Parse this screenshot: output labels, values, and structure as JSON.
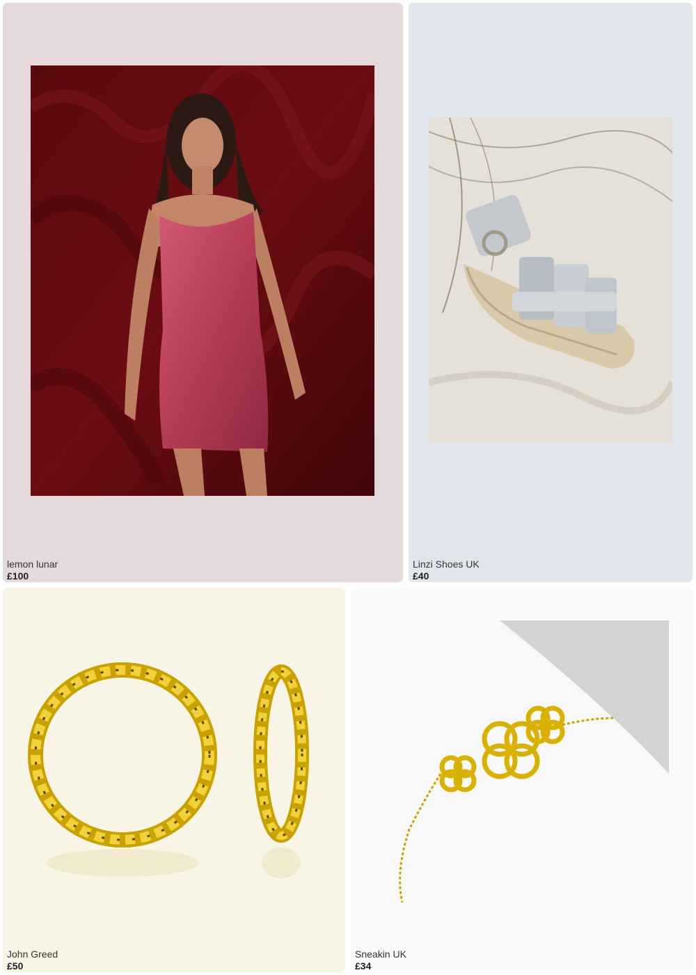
{
  "products": [
    {
      "brand": "lemon lunar",
      "price": "£100",
      "image_icon": "pink-sequin-dress-photo",
      "background": "#e5d9dc"
    },
    {
      "brand": "Linzi Shoes UK",
      "price": "£40",
      "image_icon": "silver-sandal-photo",
      "background": "#e1e5ec"
    },
    {
      "brand": "John Greed",
      "price": "£50",
      "image_icon": "gold-hoop-earrings-photo",
      "background": "#f8f5e6"
    },
    {
      "brand": "Sneakin UK",
      "price": "£34",
      "image_icon": "gold-clover-bracelet-photo",
      "background": "#fafafa"
    }
  ]
}
